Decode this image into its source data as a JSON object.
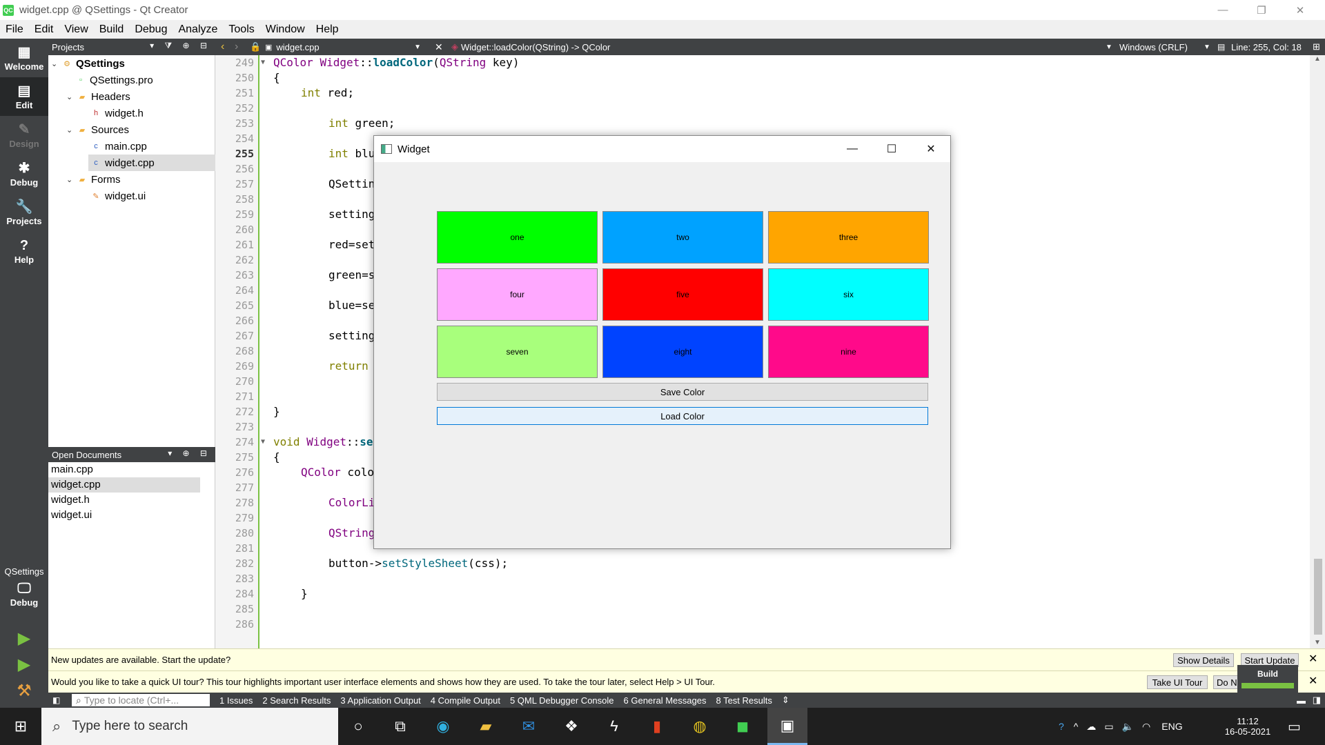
{
  "window": {
    "title": "widget.cpp @ QSettings - Qt Creator",
    "app_icon": "QC"
  },
  "menu": [
    "File",
    "Edit",
    "View",
    "Build",
    "Debug",
    "Analyze",
    "Tools",
    "Window",
    "Help"
  ],
  "modes": [
    {
      "label": "Welcome",
      "icon": "▦"
    },
    {
      "label": "Edit",
      "icon": "▤"
    },
    {
      "label": "Design",
      "icon": "✎"
    },
    {
      "label": "Debug",
      "icon": "✱"
    },
    {
      "label": "Projects",
      "icon": "🔧"
    },
    {
      "label": "Help",
      "icon": "?"
    }
  ],
  "kit": {
    "project": "QSettings",
    "mode": "Debug"
  },
  "navigator": {
    "title": "Projects",
    "tree": [
      {
        "label": "QSettings",
        "icon": "⚙"
      },
      {
        "label": "QSettings.pro",
        "icon": "▫"
      },
      {
        "label": "Headers",
        "icon": "▰"
      },
      {
        "label": "widget.h",
        "icon": "h"
      },
      {
        "label": "Sources",
        "icon": "▰"
      },
      {
        "label": "main.cpp",
        "icon": "c"
      },
      {
        "label": "widget.cpp",
        "icon": "c"
      },
      {
        "label": "Forms",
        "icon": "▰"
      },
      {
        "label": "widget.ui",
        "icon": "✎"
      }
    ]
  },
  "open_documents": {
    "title": "Open Documents",
    "items": [
      "main.cpp",
      "widget.cpp",
      "widget.h",
      "widget.ui"
    ]
  },
  "editor": {
    "file": "widget.cpp",
    "symbol": "Widget::loadColor(QString) -> QColor",
    "line_ending": "Windows (CRLF)",
    "position": "Line: 255, Col: 18",
    "current_line": "255",
    "line_numbers": [
      "249",
      "250",
      "251",
      "252",
      "253",
      "254",
      "255",
      "256",
      "257",
      "258",
      "259",
      "260",
      "261",
      "262",
      "263",
      "264",
      "265",
      "266",
      "267",
      "268",
      "269",
      "270",
      "271",
      "272",
      "273",
      "274",
      "275",
      "276",
      "277",
      "278",
      "279",
      "280",
      "281",
      "282",
      "283",
      "284",
      "285",
      "286"
    ],
    "code_parts": {
      "qcolor": "QColor",
      "widget": "Widget",
      "sep": "::",
      "loadcolor": "loadColor",
      "qstring": "QString",
      "key": " key)",
      "brace_open": "{",
      "brace_close": "}",
      "int": "int",
      "red": " red;",
      "green": " green;",
      "blu": " blu",
      "qsettin": "QSettin",
      "setting": "setting",
      "redeq": "red=set",
      "greeneq": "green=s",
      "blueeq": "blue=se",
      "setting2": "setting",
      "return": "return",
      "void": "void",
      "widget2": "Widget",
      "sep2": "::",
      "se": "se",
      "qcolor2": "QColor",
      "colo": " colo",
      "colorli": "ColorLi",
      "qstring2": "QString",
      "button": "button->",
      "setstylesheet": "setStyleSheet",
      "css": "(css);"
    }
  },
  "widget_window": {
    "title": "Widget",
    "buttons": [
      {
        "label": "one",
        "color": "#00ff00"
      },
      {
        "label": "two",
        "color": "#00a2ff"
      },
      {
        "label": "three",
        "color": "#ffa500"
      },
      {
        "label": "four",
        "color": "#ffa8ff"
      },
      {
        "label": "five",
        "color": "#ff0000"
      },
      {
        "label": "six",
        "color": "#00ffff"
      },
      {
        "label": "seven",
        "color": "#a8ff7c"
      },
      {
        "label": "eight",
        "color": "#0043ff"
      },
      {
        "label": "nine",
        "color": "#ff0a8a"
      }
    ],
    "save": "Save Color",
    "load": "Load Color"
  },
  "infobars": [
    {
      "text": "New updates are available. Start the update?",
      "buttons": [
        "Show Details",
        "Start Update"
      ]
    },
    {
      "text": "Would you like to take a quick UI tour? This tour highlights important user interface elements and shows how they are used. To take the tour later, select Help > UI Tour.",
      "buttons": [
        "Take UI Tour",
        "Do N"
      ]
    }
  ],
  "build_popup": "Build",
  "output_panes": {
    "locator_placeholder": "Type to locate (Ctrl+...",
    "panes": [
      "1  Issues",
      "2  Search Results",
      "3  Application Output",
      "4  Compile Output",
      "5  QML Debugger Console",
      "6  General Messages",
      "8  Test Results"
    ]
  },
  "taskbar": {
    "search_placeholder": "Type here to search",
    "lang": "ENG",
    "time": "11:12",
    "date": "16-05-2021"
  },
  "colors": {
    "qt_green": "#41cd52",
    "sidebar": "#404244",
    "accent": "#7ac142"
  }
}
